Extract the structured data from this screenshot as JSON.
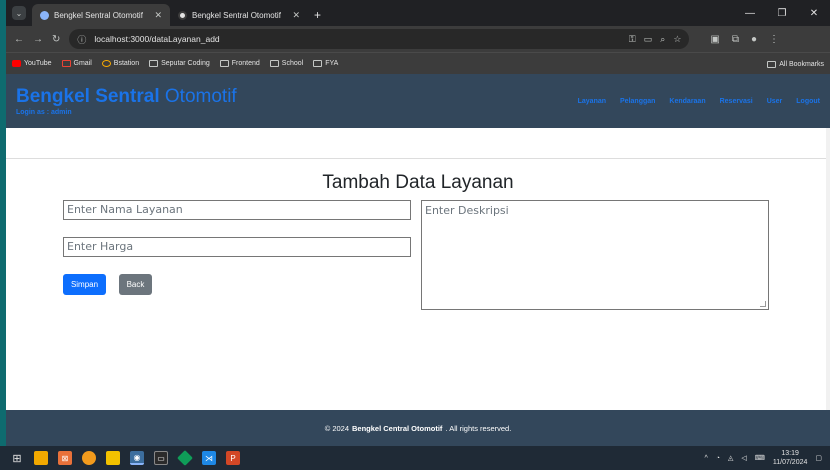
{
  "browser": {
    "tabs": [
      {
        "title": "Bengkel Sentral Otomotif",
        "active": true
      },
      {
        "title": "Bengkel Sentral Otomotif",
        "active": false
      }
    ],
    "url": "localhost:3000/dataLayanan_add",
    "bookmarks": [
      "YouTube",
      "Gmail",
      "Bstation",
      "Seputar Coding",
      "Frontend",
      "School",
      "FYA"
    ],
    "all_bookmarks": "All Bookmarks"
  },
  "header": {
    "brand_bold": "Bengkel Sentral",
    "brand_light": "Otomotif",
    "login": "Login as : admin",
    "nav": [
      "Layanan",
      "Pelanggan",
      "Kendaraan",
      "Reservasi",
      "User",
      "Logout"
    ]
  },
  "form": {
    "title": "Tambah Data Layanan",
    "nama_placeholder": "Enter Nama Layanan",
    "harga_placeholder": "Enter Harga",
    "deskripsi_placeholder": "Enter Deskripsi",
    "simpan_label": "Simpan",
    "back_label": "Back"
  },
  "footer": {
    "prefix": "© 2024",
    "brand": "Bengkel Central Otomotif",
    "suffix": ". All rights reserved."
  },
  "taskbar": {
    "time": "13:19",
    "date": "11/07/2024"
  },
  "colors": {
    "header_bg": "#33475b",
    "link": "#1a73e8",
    "primary": "#0d6efd",
    "secondary": "#6c757d"
  }
}
